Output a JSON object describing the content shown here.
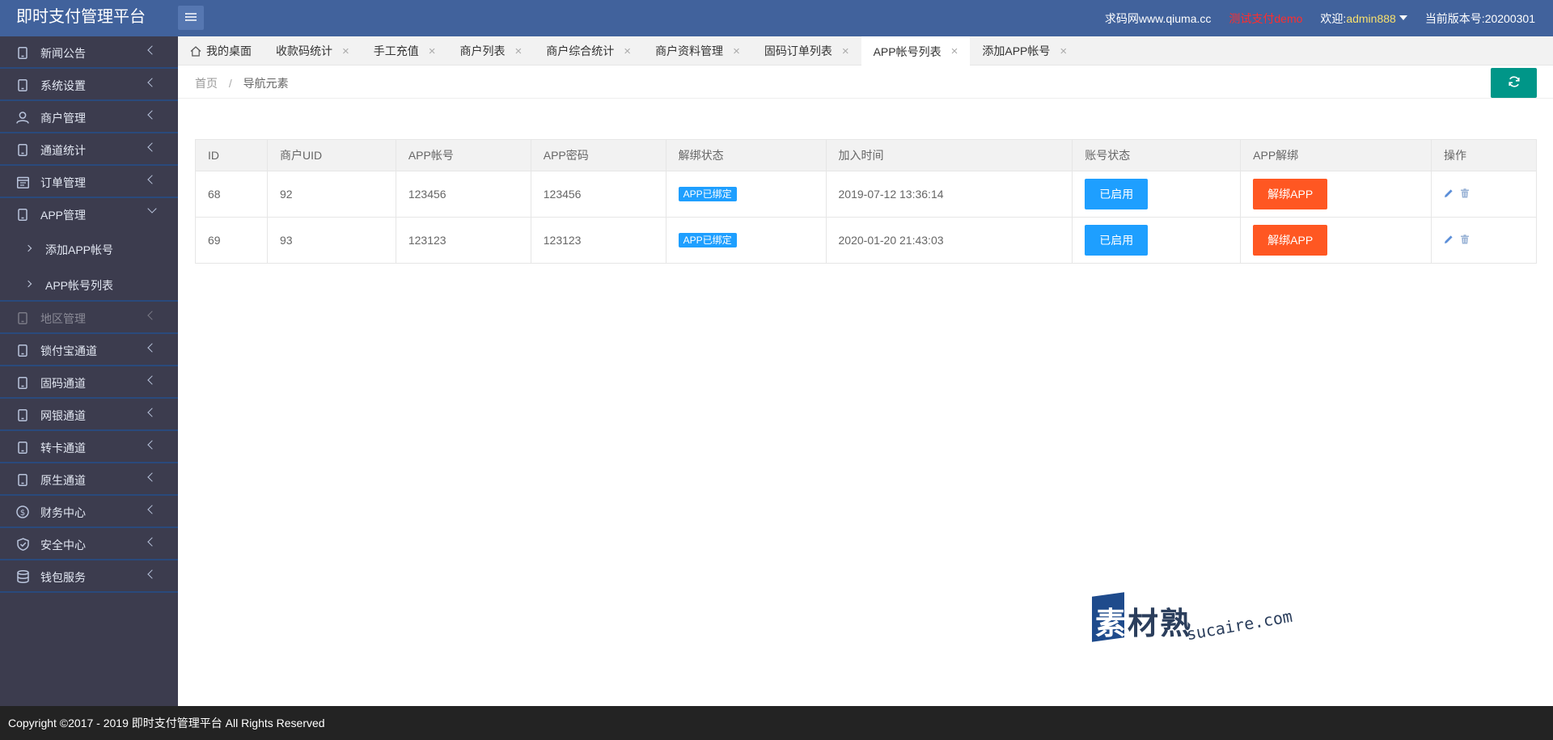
{
  "header": {
    "title": "即时支付管理平台",
    "site": "求码网www.qiuma.cc",
    "test_text": "测试支付demo",
    "welcome_label": "欢迎:",
    "username": "admin888",
    "version_label": "当前版本号:",
    "version": "20200301"
  },
  "sidebar": {
    "items": [
      {
        "label": "新闻公告"
      },
      {
        "label": "系统设置"
      },
      {
        "label": "商户管理"
      },
      {
        "label": "通道统计"
      },
      {
        "label": "订单管理"
      },
      {
        "label": "APP管理"
      },
      {
        "label": "地区管理"
      },
      {
        "label": "锁付宝通道"
      },
      {
        "label": "固码通道"
      },
      {
        "label": "网银通道"
      },
      {
        "label": "转卡通道"
      },
      {
        "label": "原生通道"
      },
      {
        "label": "财务中心"
      },
      {
        "label": "安全中心"
      },
      {
        "label": "钱包服务"
      }
    ],
    "sub_items": [
      {
        "label": "添加APP帐号"
      },
      {
        "label": "APP帐号列表"
      }
    ]
  },
  "tabs": [
    {
      "label": "我的桌面"
    },
    {
      "label": "收款码统计"
    },
    {
      "label": "手工充值"
    },
    {
      "label": "商户列表"
    },
    {
      "label": "商户综合统计"
    },
    {
      "label": "商户资料管理"
    },
    {
      "label": "固码订单列表"
    },
    {
      "label": "APP帐号列表"
    },
    {
      "label": "添加APP帐号"
    }
  ],
  "tab_close": "×",
  "breadcrumb": {
    "home": "首页",
    "separator": "/",
    "current": "导航元素"
  },
  "table": {
    "headers": [
      "ID",
      "商户UID",
      "APP帐号",
      "APP密码",
      "解绑状态",
      "加入时间",
      "账号状态",
      "APP解绑",
      "操作"
    ],
    "rows": [
      {
        "id": "68",
        "uid": "92",
        "account": "123456",
        "password": "123456",
        "bind_status": "APP已绑定",
        "join_time": "2019-07-12 13:36:14",
        "account_status": "已启用",
        "unbind": "解绑APP"
      },
      {
        "id": "69",
        "uid": "93",
        "account": "123123",
        "password": "123123",
        "bind_status": "APP已绑定",
        "join_time": "2020-01-20 21:43:03",
        "account_status": "已启用",
        "unbind": "解绑APP"
      }
    ]
  },
  "watermark": {
    "first_char": "素",
    "rest_chars": "材熟",
    "url": "sucaire.com"
  },
  "footer": {
    "copyright": "Copyright ©2017 - 2019 即时支付管理平台 All Rights Reserved"
  },
  "colors": {
    "header": "#41629c",
    "sidebar": "#3c3c4e",
    "primary_blue": "#1e9fff",
    "danger_orange": "#ff5722",
    "refresh_green": "#009688",
    "footer": "#232323"
  }
}
